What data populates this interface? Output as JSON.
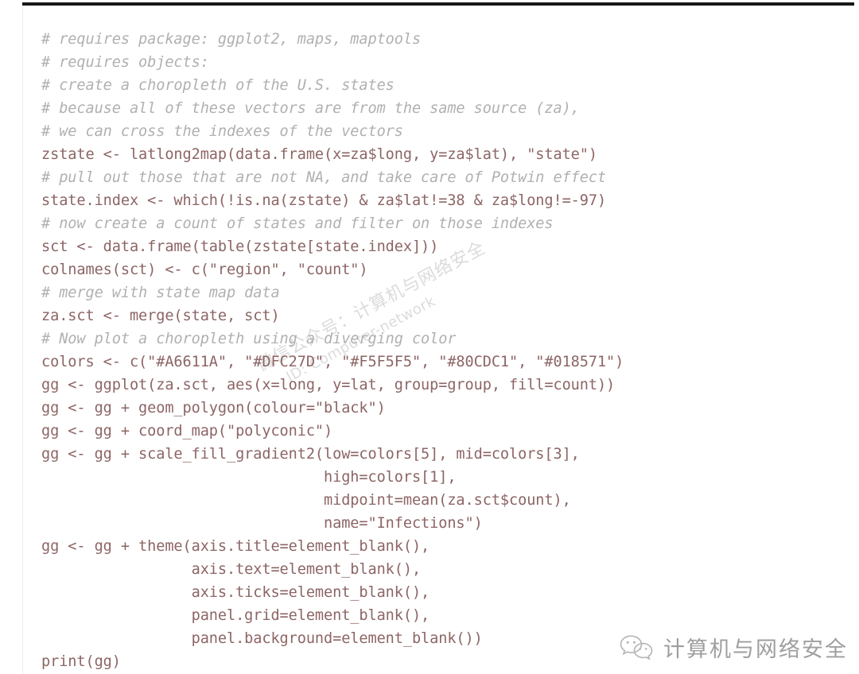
{
  "document": {
    "kind": "code-listing",
    "language": "R",
    "code_color": "#8d6565",
    "comment_color": "#b0b0b0",
    "background_color": "#ffffff",
    "top_rule_color": "#171717"
  },
  "code": {
    "lines": [
      {
        "type": "comment",
        "text": "# requires package: ggplot2, maps, maptools"
      },
      {
        "type": "comment",
        "text": "# requires objects:"
      },
      {
        "type": "comment",
        "text": "# create a choropleth of the U.S. states"
      },
      {
        "type": "comment",
        "text": "# because all of these vectors are from the same source (za),"
      },
      {
        "type": "comment",
        "text": "# we can cross the indexes of the vectors"
      },
      {
        "type": "code",
        "text": "zstate <- latlong2map(data.frame(x=za$long, y=za$lat), \"state\")"
      },
      {
        "type": "comment",
        "text": "# pull out those that are not NA, and take care of Potwin effect"
      },
      {
        "type": "code",
        "text": "state.index <- which(!is.na(zstate) & za$lat!=38 & za$long!=-97)"
      },
      {
        "type": "comment",
        "text": "# now create a count of states and filter on those indexes"
      },
      {
        "type": "code",
        "text": "sct <- data.frame(table(zstate[state.index]))"
      },
      {
        "type": "code",
        "text": "colnames(sct) <- c(\"region\", \"count\")"
      },
      {
        "type": "comment",
        "text": "# merge with state map data"
      },
      {
        "type": "code",
        "text": "za.sct <- merge(state, sct)"
      },
      {
        "type": "comment",
        "text": "# Now plot a choropleth using a diverging color"
      },
      {
        "type": "code",
        "text": "colors <- c(\"#A6611A\", \"#DFC27D\", \"#F5F5F5\", \"#80CDC1\", \"#018571\")"
      },
      {
        "type": "code",
        "text": "gg <- ggplot(za.sct, aes(x=long, y=lat, group=group, fill=count))"
      },
      {
        "type": "code",
        "text": "gg <- gg + geom_polygon(colour=\"black\")"
      },
      {
        "type": "code",
        "text": "gg <- gg + coord_map(\"polyconic\")"
      },
      {
        "type": "code",
        "text": "gg <- gg + scale_fill_gradient2(low=colors[5], mid=colors[3],"
      },
      {
        "type": "code",
        "text": "                                high=colors[1],"
      },
      {
        "type": "code",
        "text": "                                midpoint=mean(za.sct$count),"
      },
      {
        "type": "code",
        "text": "                                name=\"Infections\")"
      },
      {
        "type": "code",
        "text": "gg <- gg + theme(axis.title=element_blank(),"
      },
      {
        "type": "code",
        "text": "                 axis.text=element_blank(),"
      },
      {
        "type": "code",
        "text": "                 axis.ticks=element_blank(),"
      },
      {
        "type": "code",
        "text": "                 panel.grid=element_blank(),"
      },
      {
        "type": "code",
        "text": "                 panel.background=element_blank())"
      },
      {
        "type": "code",
        "text": "print(gg)"
      }
    ],
    "palette_literals": [
      "#A6611A",
      "#DFC27D",
      "#F5F5F5",
      "#80CDC1",
      "#018571"
    ]
  },
  "watermark": {
    "line1": "微信公众号：计算机与网络安全",
    "line2": "ID: Computer-network"
  },
  "badge": {
    "icon": "wechat-icon",
    "label": "计算机与网络安全"
  }
}
